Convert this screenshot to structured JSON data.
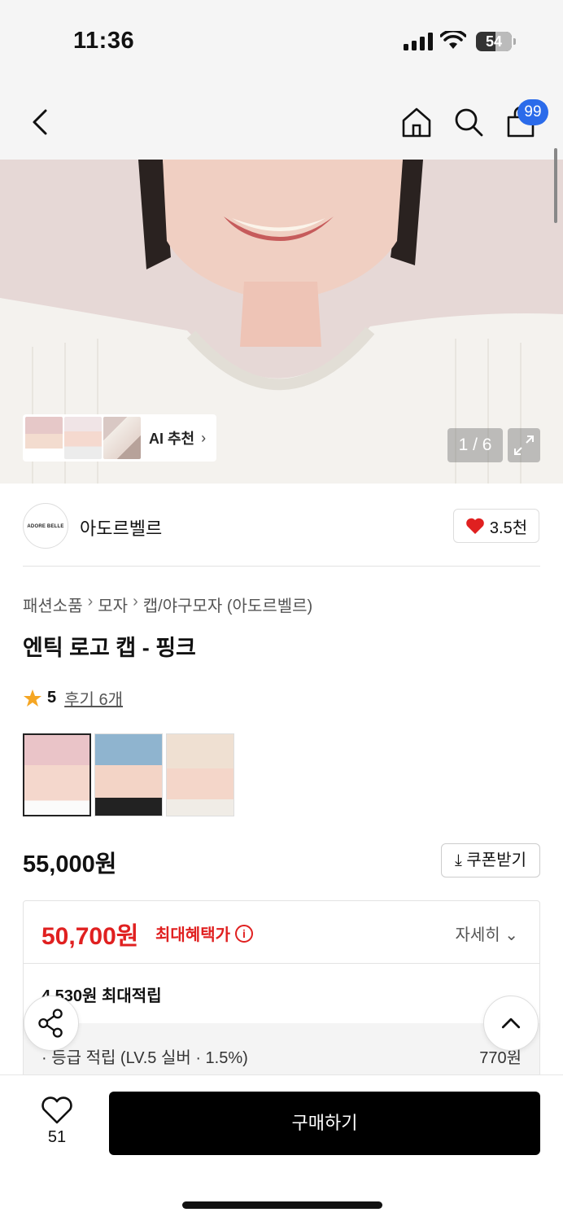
{
  "status_bar": {
    "time": "11:36",
    "battery": "54"
  },
  "nav": {
    "badge_count": "99"
  },
  "hero": {
    "ai_label": "AI 추천",
    "pager": "1 / 6"
  },
  "brand": {
    "logo_text": "ADORE BELLE",
    "name": "아도르벨르",
    "likes": "3.5천"
  },
  "breadcrumb": [
    "패션소품",
    "모자",
    "캡/야구모자 (아도르벨르)"
  ],
  "product": {
    "title": "엔틱 로고 캡 - 핑크",
    "rating": "5",
    "reviews": "후기 6개",
    "price": "55,000원",
    "coupon_label": "쿠폰받기",
    "color_options": [
      "pink",
      "blue",
      "beige"
    ]
  },
  "benefit": {
    "max_price": "50,700원",
    "max_label": "최대혜택가",
    "detail_label": "자세히",
    "points": "4,530원 최대적립",
    "tier_label": "· 등급 적립 (LV.5 실버 · 1.5%)",
    "tier_amount": "770원"
  },
  "bottom": {
    "wish_count": "51",
    "buy_label": "구매하기"
  },
  "colors": {
    "accent_red": "#e02020",
    "badge_blue": "#2b6bea"
  }
}
